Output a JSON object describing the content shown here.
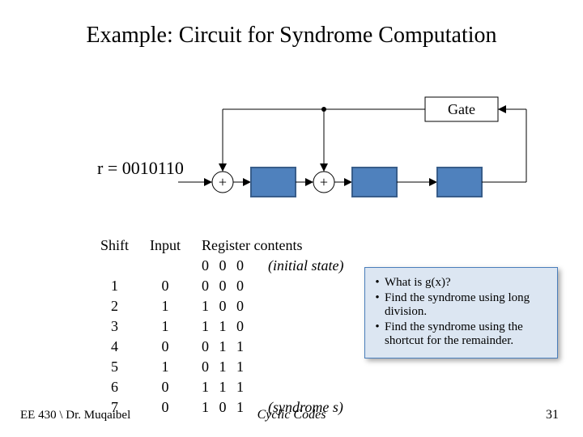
{
  "title": "Example: Circuit for Syndrome Computation",
  "gate_label": "Gate",
  "r_label": "r = 0010110",
  "table": {
    "headers": [
      "Shift",
      "Input",
      "Register contents"
    ],
    "initial_note": "(initial state)",
    "rows": [
      {
        "shift": "",
        "input": "",
        "reg": "0 0 0",
        "note": "(initial state)"
      },
      {
        "shift": "1",
        "input": "0",
        "reg": "0 0 0",
        "note": ""
      },
      {
        "shift": "2",
        "input": "1",
        "reg": "1 0 0",
        "note": ""
      },
      {
        "shift": "3",
        "input": "1",
        "reg": "1 1 0",
        "note": ""
      },
      {
        "shift": "4",
        "input": "0",
        "reg": "0 1 1",
        "note": ""
      },
      {
        "shift": "5",
        "input": "1",
        "reg": "0 1 1",
        "note": ""
      },
      {
        "shift": "6",
        "input": "0",
        "reg": "1 1 1",
        "note": ""
      },
      {
        "shift": "7",
        "input": "0",
        "reg": "1 0 1",
        "note": "(syndrome s)"
      }
    ]
  },
  "callout": {
    "items": [
      "What is g(x)?",
      "Find the syndrome using long division.",
      "Find the syndrome using the shortcut for the remainder."
    ]
  },
  "footer": {
    "left": "EE 430 \\ Dr. Muqaibel",
    "center": "Cyclic Codes",
    "right": "31"
  },
  "circuit": {
    "registers": 3,
    "adders": 2,
    "feedback_taps": [
      0,
      1
    ],
    "input": "r"
  }
}
